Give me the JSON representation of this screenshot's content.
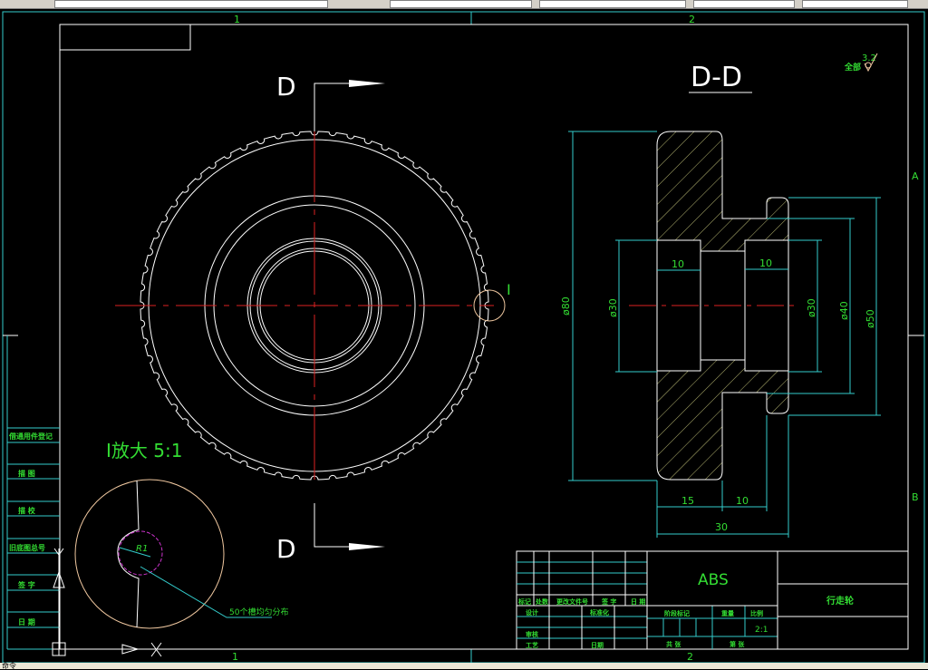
{
  "colors": {
    "background": "#000000",
    "frame": "#ffffff",
    "border": "#33cccc",
    "dimension": "#33cccc",
    "text": "#33dd33",
    "centerline": "#dd2222",
    "detail_circle": "#f0c8a0",
    "magenta": "#cc33cc",
    "hatch": "#e8e890"
  },
  "statusbar": {
    "text": "命令"
  },
  "zones": {
    "top": [
      "1",
      "2"
    ],
    "bottom": [
      "1",
      "2"
    ],
    "right": [
      "A",
      "B"
    ]
  },
  "front_view": {
    "section_label_top": "D",
    "section_label_bottom": "D",
    "detail_marker": "I",
    "tooth_count": 60
  },
  "section_view": {
    "title": "D-D",
    "dims": {
      "dia_outer": "ø80",
      "dia_bore_left": "ø30",
      "dia_bore_right": "ø30",
      "dia_hub": "ø40",
      "dia_flange": "ø50",
      "bore_depth_left": "10",
      "bore_depth_right": "10",
      "rim_width": "15",
      "hub_width": "10",
      "total_width": "30"
    }
  },
  "roughness": {
    "prefix": "全部",
    "value": "3.2"
  },
  "detail_view": {
    "title": "I放大 5:1",
    "radius_label": "R1",
    "note": "50个槽均匀分布"
  },
  "left_table": {
    "rows": [
      "借通用件登记",
      "描 图",
      "描 校",
      "旧底图总号",
      "签 字",
      "日 期"
    ]
  },
  "title_block": {
    "material": "ABS",
    "part_name": "行走轮",
    "scale": "2:1",
    "header": [
      "标记",
      "处数",
      "更改文件号",
      "签 字",
      "日 期"
    ],
    "design": "设计",
    "standardization": "标准化",
    "review": "审核",
    "process": "工艺",
    "date": "日期",
    "stage_mark": "阶段标记",
    "weight": "重量",
    "scale_label": "比例",
    "sheets_total": "共  张",
    "sheet_no": "第  张"
  }
}
